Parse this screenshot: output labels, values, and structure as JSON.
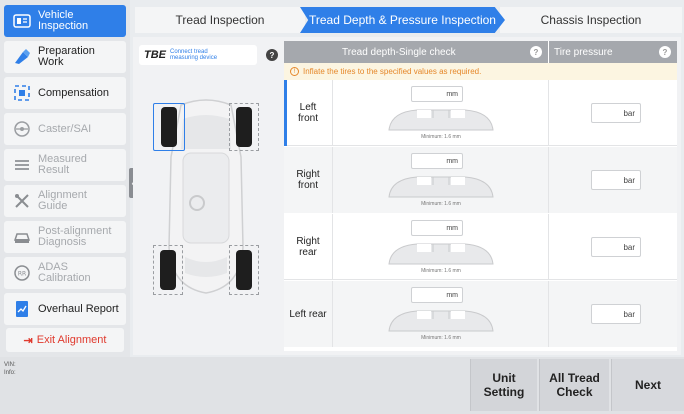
{
  "sidebar": {
    "items": [
      {
        "label": "Vehicle\nInspection",
        "icon": "vehicle-inspection-icon",
        "state": "active"
      },
      {
        "label": "Preparation\nWork",
        "icon": "preparation-icon",
        "state": "normal"
      },
      {
        "label": "Compensation",
        "icon": "compensation-icon",
        "state": "normal"
      },
      {
        "label": "Caster/SAI",
        "icon": "caster-icon",
        "state": "disabled"
      },
      {
        "label": "Measured\nResult",
        "icon": "measured-result-icon",
        "state": "disabled"
      },
      {
        "label": "Alignment\nGuide",
        "icon": "alignment-guide-icon",
        "state": "disabled"
      },
      {
        "label": "Post-alignment\nDiagnosis",
        "icon": "post-alignment-icon",
        "state": "disabled"
      },
      {
        "label": "ADAS\nCalibration",
        "icon": "adas-icon",
        "state": "disabled"
      },
      {
        "label": "Overhaul Report",
        "icon": "report-icon",
        "state": "normal"
      }
    ],
    "exit_label": "Exit Alignment",
    "collapse_glyph": "‹"
  },
  "tabs": [
    {
      "label": "Tread Inspection"
    },
    {
      "label": "Tread Depth & Pressure Inspection"
    },
    {
      "label": "Chassis Inspection"
    }
  ],
  "tbe": {
    "logo": "TBE",
    "connect_text": "Connect tread\nmeasuring device",
    "help": "?"
  },
  "table": {
    "header_tread": "Tread depth-Single check",
    "header_pressure": "Tire pressure",
    "help": "?",
    "notice_icon": "!",
    "notice": "Inflate the tires to the specified values as required.",
    "rows": [
      {
        "position": "Left\nfront",
        "mm_unit": "mm",
        "min_text": "Minimum: 1.6 mm",
        "bar_unit": "bar"
      },
      {
        "position": "Right\nfront",
        "mm_unit": "mm",
        "min_text": "Minimum: 1.6 mm",
        "bar_unit": "bar"
      },
      {
        "position": "Right\nrear",
        "mm_unit": "mm",
        "min_text": "Minimum: 1.6 mm",
        "bar_unit": "bar"
      },
      {
        "position": "Left rear",
        "mm_unit": "mm",
        "min_text": "Minimum: 1.6 mm",
        "bar_unit": "bar"
      }
    ]
  },
  "footer": {
    "vin": "VIN:",
    "info": "Info:",
    "unit_setting": "Unit\nSetting",
    "all_tread_check": "All Tread\nCheck",
    "next": "Next"
  },
  "colors": {
    "accent": "#2f7fe8",
    "notice_text": "#e5872a",
    "exit_red": "#e03a2e"
  }
}
